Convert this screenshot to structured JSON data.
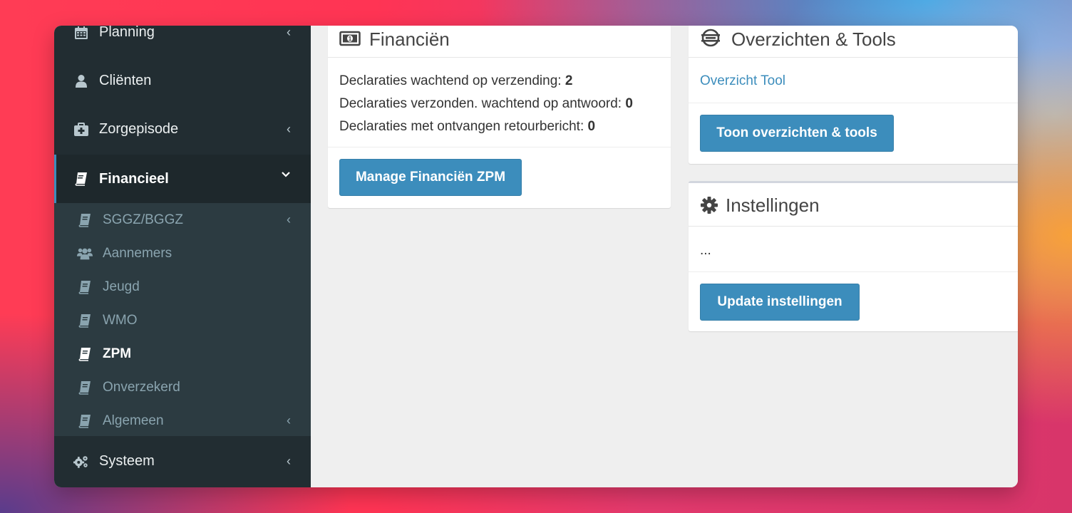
{
  "sidebar": {
    "items": [
      {
        "label": "Planning",
        "icon": "calendar-icon",
        "chevron": "‹"
      },
      {
        "label": "Cliënten",
        "icon": "user-icon",
        "chevron": ""
      },
      {
        "label": "Zorgepisode",
        "icon": "medkit-icon",
        "chevron": "‹"
      },
      {
        "label": "Financieel",
        "icon": "book-icon",
        "chevron": "⌄"
      },
      {
        "label": "Systeem",
        "icon": "gears-icon",
        "chevron": "‹"
      }
    ],
    "submenu": [
      {
        "label": "SGGZ/BGGZ",
        "icon": "book-icon",
        "chevron": "‹"
      },
      {
        "label": "Aannemers",
        "icon": "users-icon",
        "chevron": ""
      },
      {
        "label": "Jeugd",
        "icon": "book-icon",
        "chevron": ""
      },
      {
        "label": "WMO",
        "icon": "book-icon",
        "chevron": ""
      },
      {
        "label": "ZPM",
        "icon": "book-icon",
        "chevron": ""
      },
      {
        "label": "Onverzekerd",
        "icon": "book-icon",
        "chevron": ""
      },
      {
        "label": "Algemeen",
        "icon": "book-icon",
        "chevron": "‹"
      }
    ]
  },
  "financien": {
    "title": "Financiën",
    "icon": "money-icon",
    "lines": [
      {
        "label": "Declaraties wachtend op verzending: ",
        "value": "2"
      },
      {
        "label": "Declaraties verzonden. wachtend op antwoord: ",
        "value": "0"
      },
      {
        "label": "Declaraties met ontvangen retourbericht: ",
        "value": "0"
      }
    ],
    "button": "Manage Financiën ZPM"
  },
  "overzichten": {
    "title": "Overzichten & Tools",
    "icon": "list-circle-icon",
    "link": "Overzicht Tool",
    "button": "Toon overzichten & tools"
  },
  "instellingen": {
    "title": "Instellingen",
    "icon": "gear-icon",
    "body": "...",
    "button": "Update instellingen"
  },
  "colors": {
    "sidebar_bg": "#222d32",
    "submenu_bg": "#2c3b41",
    "accent": "#3c8dbc"
  }
}
